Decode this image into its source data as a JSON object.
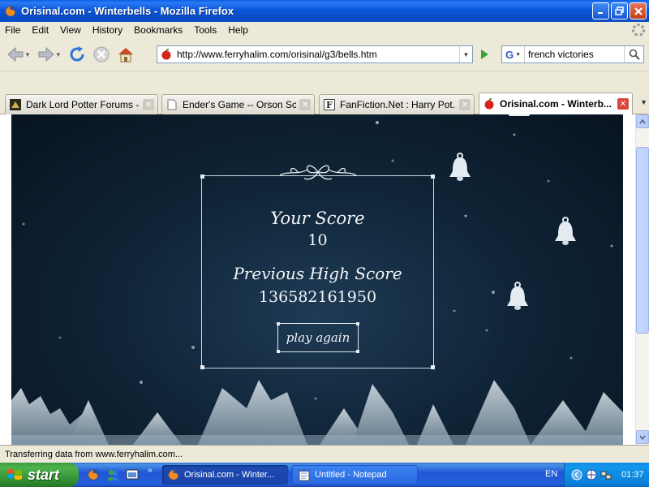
{
  "window": {
    "title": "Orisinal.com - Winterbells - Mozilla Firefox"
  },
  "menu": {
    "items": [
      "File",
      "Edit",
      "View",
      "History",
      "Bookmarks",
      "Tools",
      "Help"
    ]
  },
  "navigation": {
    "url": "http://www.ferryhalim.com/orisinal/g3/bells.htm",
    "search_engine_label": "G",
    "search_value": "french victories"
  },
  "tabs": [
    {
      "label": "Dark Lord Potter Forums - ...",
      "icon": "forum-favicon",
      "active": false
    },
    {
      "label": "Ender's Game -- Orson Sco...",
      "icon": "page-favicon",
      "active": false
    },
    {
      "label": "FanFiction.Net : Harry Pot...",
      "icon": "fanfiction-favicon",
      "active": false
    },
    {
      "label": "Orisinal.com - Winterb...",
      "icon": "orisinal-favicon",
      "active": true
    }
  ],
  "game": {
    "score_label": "Your Score",
    "score_value": "10",
    "high_label": "Previous High Score",
    "high_value": "136582161950",
    "play_again_label": "play again"
  },
  "status": {
    "text": "Transferring data from www.ferryhalim.com..."
  },
  "taskbar": {
    "start_label": "start",
    "items": [
      {
        "label": "Orisinal.com - Winter...",
        "active": true
      },
      {
        "label": "Untitled - Notepad",
        "active": false
      }
    ],
    "language": "EN",
    "clock": "01:37"
  },
  "colors": {
    "title_bar": "#0b58d9",
    "game_background": "#102538",
    "taskbar": "#245edb",
    "start_button": "#3c9a3c"
  }
}
